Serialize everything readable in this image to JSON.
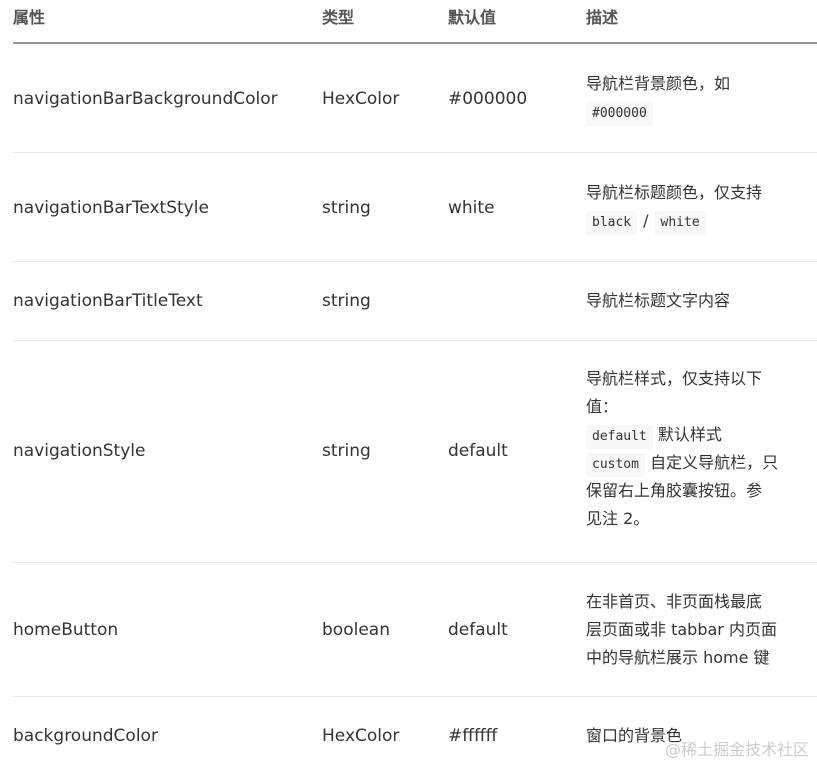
{
  "header": {
    "col1": "属性",
    "col2": "类型",
    "col3": "默认值",
    "col4": "描述"
  },
  "rows": [
    {
      "name": "navigationBarBackgroundColor",
      "type": "HexColor",
      "default": "#000000",
      "desc_text": "导航栏背景颜色，如",
      "desc_code": "#000000"
    },
    {
      "name": "navigationBarTextStyle",
      "type": "string",
      "default": "white",
      "desc_text": "导航栏标题颜色，仅支持",
      "desc_code1": "black",
      "desc_sep": "/",
      "desc_code2": "white"
    },
    {
      "name": "navigationBarTitleText",
      "type": "string",
      "default": "",
      "desc_text": "导航栏标题文字内容"
    },
    {
      "name": "navigationStyle",
      "type": "string",
      "default": "default",
      "desc_line1": "导航栏样式，仅支持以下",
      "desc_line2": "值：",
      "desc_code1": "default",
      "desc_after1": "默认样式",
      "desc_code2": "custom",
      "desc_after2": "自定义导航栏，只",
      "desc_line5": "保留右上角胶囊按钮。参",
      "desc_line6": "见注 2。"
    },
    {
      "name": "homeButton",
      "type": "boolean",
      "default": "default",
      "desc_line1": "在非首页、非页面栈最底",
      "desc_line2": "层页面或非 tabbar 内页面",
      "desc_line3": "中的导航栏展示 home 键"
    },
    {
      "name": "backgroundColor",
      "type": "HexColor",
      "default": "#ffffff",
      "desc_text": "窗口的背景色"
    }
  ],
  "watermark": "@稀土掘金技术社区"
}
